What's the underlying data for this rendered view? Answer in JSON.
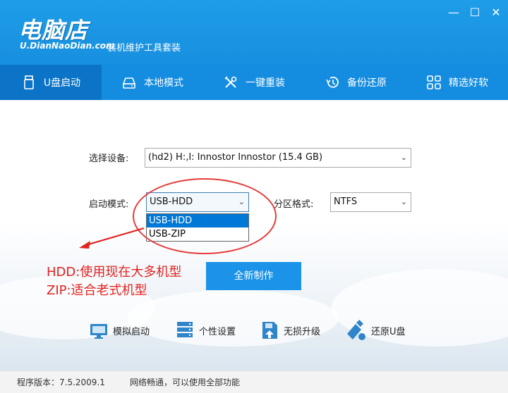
{
  "app": {
    "logo_title": "电脑店",
    "logo_domain": "U.DianNaoDian.com",
    "tagline": "装机维护工具套装"
  },
  "window_controls": {
    "minimize": "—",
    "maximize": "☐",
    "close": "✕"
  },
  "nav": {
    "items": [
      {
        "label": "U盘启动",
        "icon": "usb-drive-icon",
        "active": true
      },
      {
        "label": "本地模式",
        "icon": "hard-disk-icon",
        "active": false
      },
      {
        "label": "一键重装",
        "icon": "tools-icon",
        "active": false
      },
      {
        "label": "备份还原",
        "icon": "restore-icon",
        "active": false
      },
      {
        "label": "精选好软",
        "icon": "apps-grid-icon",
        "active": false
      }
    ]
  },
  "form": {
    "device_label": "选择设备:",
    "device_value": "(hd2) H:,I: Innostor Innostor (15.4 GB)",
    "boot_mode_label": "启动模式:",
    "boot_mode_value": "USB-HDD",
    "boot_mode_options": [
      "USB-HDD",
      "USB-ZIP"
    ],
    "partition_label": "分区格式:",
    "partition_value": "NTFS"
  },
  "annotation": {
    "line1": "HDD:使用现在大多机型",
    "line2": "ZIP:适合老式机型",
    "color": "#e2221f"
  },
  "primary_button": "全新制作",
  "tools": [
    {
      "label": "模拟启动",
      "icon": "monitor-icon"
    },
    {
      "label": "个性设置",
      "icon": "server-settings-icon"
    },
    {
      "label": "无损升级",
      "icon": "upgrade-icon"
    },
    {
      "label": "还原U盘",
      "icon": "usb-restore-icon"
    }
  ],
  "status": {
    "version": "程序版本：7.5.2009.1",
    "network": "网络畅通，可以使用全部功能"
  },
  "colors": {
    "header": "#1f9de8",
    "nav": "#148ce0",
    "nav_active": "#0b74c6",
    "primary": "#1a93e8",
    "annotation": "#e2221f"
  }
}
